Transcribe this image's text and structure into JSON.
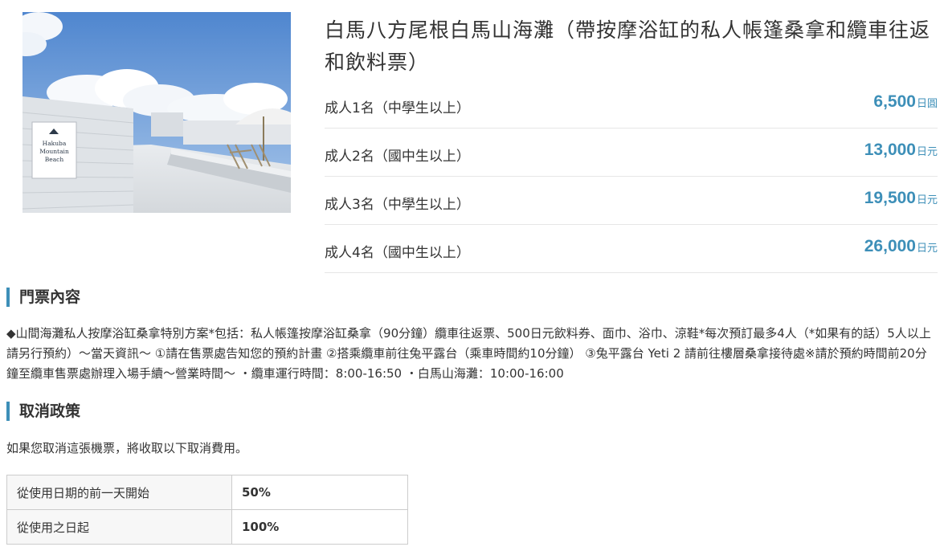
{
  "product": {
    "title": "白馬八方尾根白馬山海灘（帶按摩浴缸的私人帳篷桑拿和纜車往返和飲料票）",
    "image_sign": "Hakuba Mountain Beach"
  },
  "prices": [
    {
      "label": "成人1名（中學生以上）",
      "amount": "6,500",
      "currency": "日圓"
    },
    {
      "label": "成人2名（國中生以上）",
      "amount": "13,000",
      "currency": "日元"
    },
    {
      "label": "成人3名（中學生以上）",
      "amount": "19,500",
      "currency": "日元"
    },
    {
      "label": "成人4名（國中生以上）",
      "amount": "26,000",
      "currency": "日元"
    }
  ],
  "ticket_content": {
    "heading": "門票內容",
    "text": "◆山間海灘私人按摩浴缸桑拿特別方案*包括：私人帳篷按摩浴缸桑拿（90分鐘）纜車往返票、500日元飲料券、面巾、浴巾、涼鞋*每次預訂最多4人（*如果有的話）5人以上請另行預約）～當天資訊～ ①請在售票處告知您的預約計畫 ②搭乘纜車前往兔平露台（乘車時間約10分鐘） ③兔平露台 Yeti 2 請前往樓層桑拿接待處※請於預約時間前20分鐘至纜車售票處辦理入場手續～營業時間～ ・纜車運行時間：8:00-16:50 ・白馬山海灘：10:00-16:00"
  },
  "cancellation": {
    "heading": "取消政策",
    "intro": "如果您取消這張機票，將收取以下取消費用。",
    "rows": [
      {
        "period": "從使用日期的前一天開始",
        "fee": "50%"
      },
      {
        "period": "從使用之日起",
        "fee": "100%"
      }
    ]
  },
  "colors": {
    "accent": "#3d8fb8",
    "border": "#cccccc",
    "text": "#333333"
  }
}
